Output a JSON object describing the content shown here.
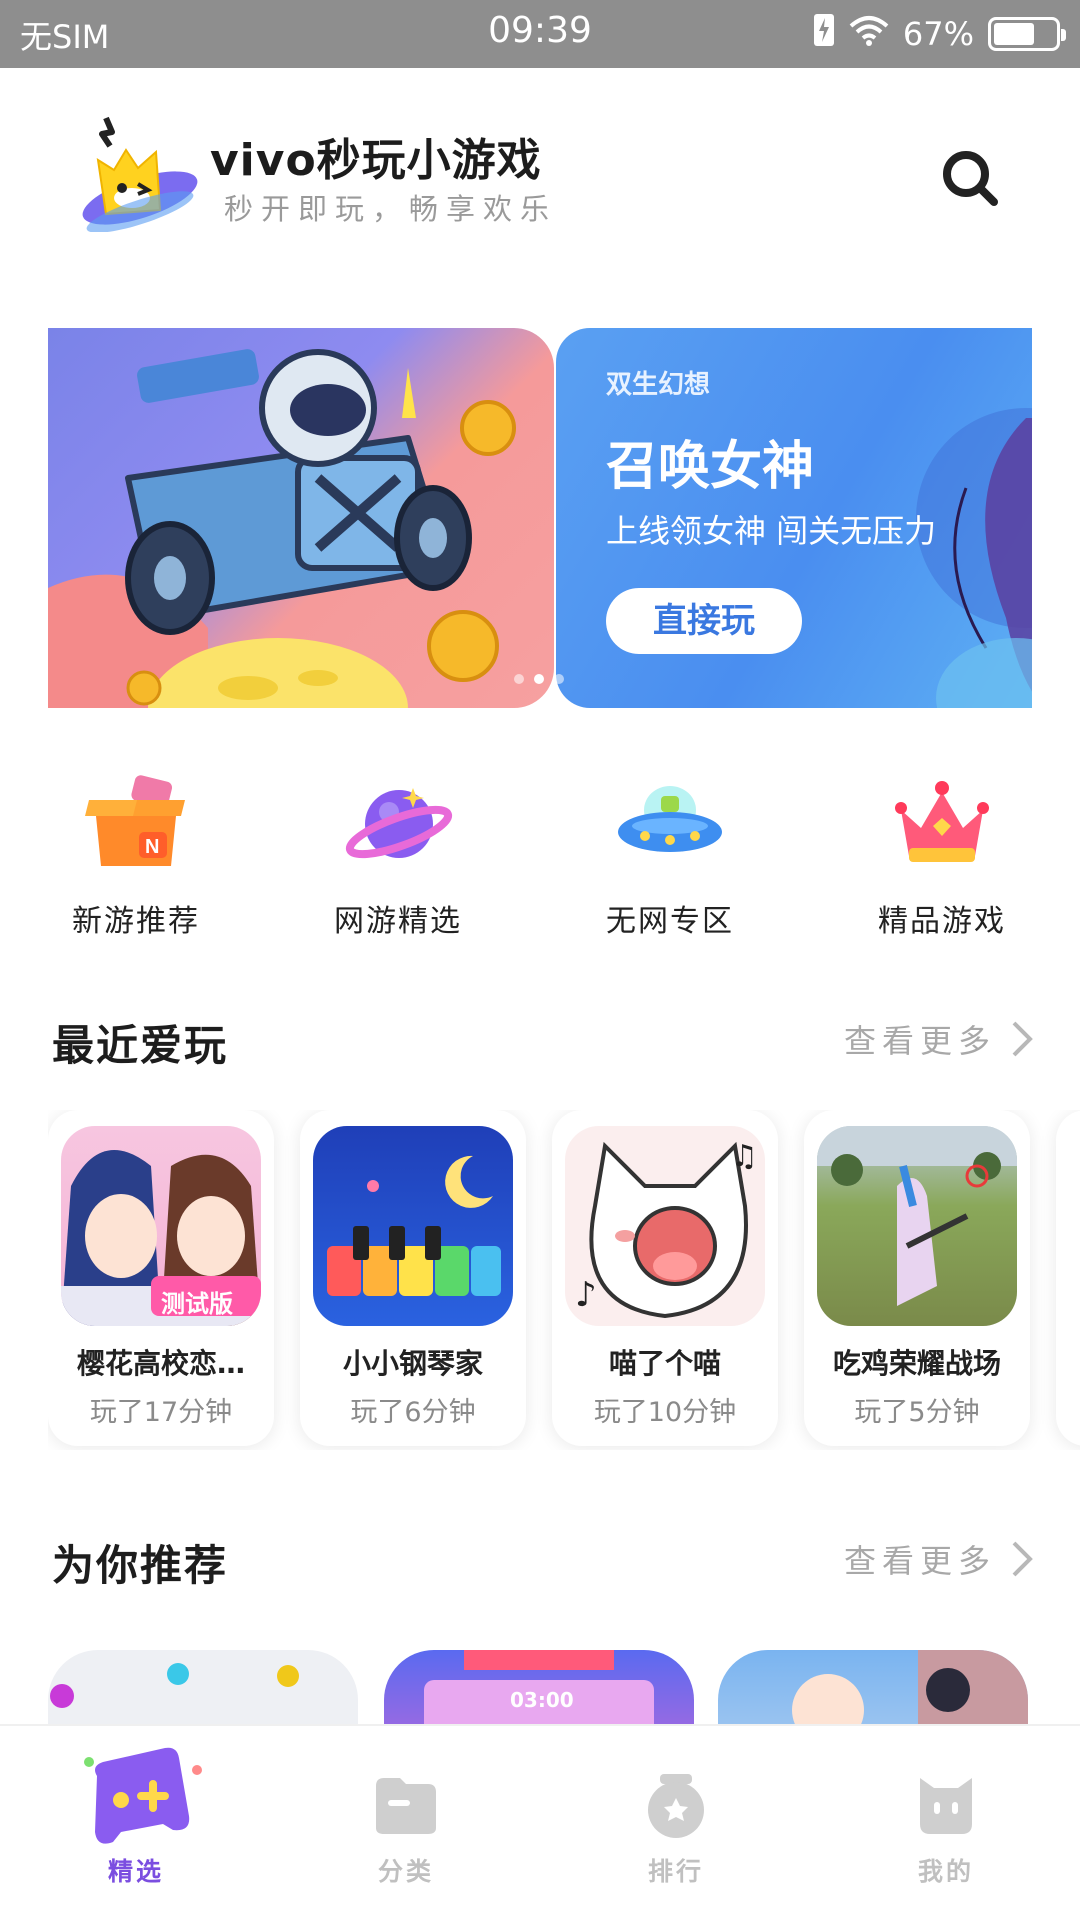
{
  "status_bar": {
    "carrier": "无SIM",
    "time": "09:39",
    "battery_percent": "67%",
    "battery_level": 0.67
  },
  "header": {
    "title": "vivo秒玩小游戏",
    "subtitle": "秒开即玩，畅享欢乐"
  },
  "banner": {
    "game_name": "双生幻想",
    "headline": "召唤女神",
    "subline": "上线领女神 闯关无压力",
    "play_label": "直接玩",
    "slide_count": 3,
    "active_slide": 1
  },
  "quick_nav": [
    {
      "label": "新游推荐",
      "icon": "new-games-box-icon"
    },
    {
      "label": "网游精选",
      "icon": "planet-icon"
    },
    {
      "label": "无网专区",
      "icon": "ufo-icon"
    },
    {
      "label": "精品游戏",
      "icon": "crown-icon"
    }
  ],
  "recent": {
    "title": "最近爱玩",
    "more": "查看更多",
    "games": [
      {
        "name": "樱花高校恋…",
        "time": "玩了17分钟",
        "thumb_label": "测试版"
      },
      {
        "name": "小小钢琴家",
        "time": "玩了6分钟"
      },
      {
        "name": "喵了个喵",
        "time": "玩了10分钟"
      },
      {
        "name": "吃鸡荣耀战场",
        "time": "玩了5分钟"
      }
    ]
  },
  "recommend": {
    "title": "为你推荐",
    "more": "查看更多",
    "timer_text": "03:00"
  },
  "bottom_nav": [
    {
      "label": "精选",
      "active": true,
      "icon": "gamepad-icon"
    },
    {
      "label": "分类",
      "active": false,
      "icon": "folder-icon"
    },
    {
      "label": "排行",
      "active": false,
      "icon": "trophy-icon"
    },
    {
      "label": "我的",
      "active": false,
      "icon": "profile-icon"
    }
  ],
  "colors": {
    "accent": "#7b4ee0",
    "banner_blue": "#4a8ef0",
    "status_bar": "#8e8e8e"
  }
}
